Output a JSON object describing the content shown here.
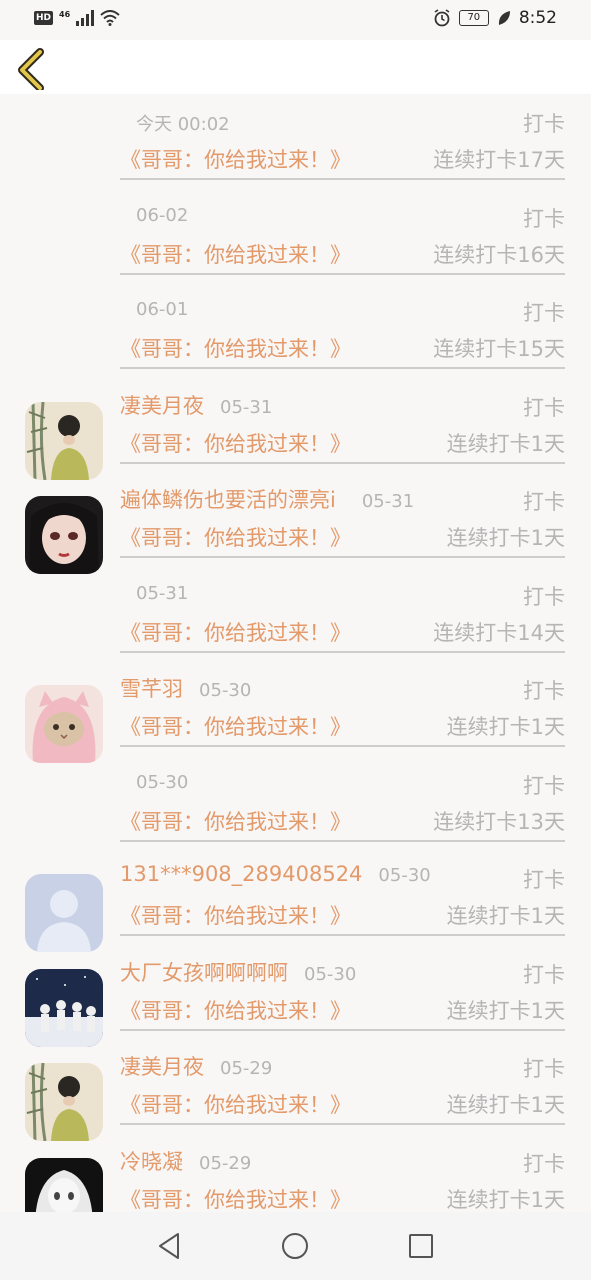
{
  "status_bar": {
    "hd": "HD",
    "network": "46",
    "battery": "70",
    "time": "8:52",
    "icons": [
      "signal-icon",
      "wifi-icon",
      "alarm-icon",
      "battery-icon",
      "leaf-icon"
    ]
  },
  "header": {
    "back_icon": "chevron-left-icon",
    "accent": "#e3c74a"
  },
  "colors": {
    "accent_text": "#e39a6a",
    "muted_text": "#b5b5b5",
    "divider": "#cfcccc"
  },
  "records": [
    {
      "avatar": null,
      "name": "",
      "date": "今天 00:02",
      "action": "打卡",
      "book": "《哥哥：你给我过来！》",
      "streak": "连续打卡17天"
    },
    {
      "avatar": null,
      "name": "",
      "date": "06-02",
      "action": "打卡",
      "book": "《哥哥：你给我过来！》",
      "streak": "连续打卡16天"
    },
    {
      "avatar": null,
      "name": "",
      "date": "06-01",
      "action": "打卡",
      "book": "《哥哥：你给我过来！》",
      "streak": "连续打卡15天"
    },
    {
      "avatar": "girl-bamboo",
      "name": "凄美月夜",
      "date": "05-31",
      "action": "打卡",
      "book": "《哥哥：你给我过来！》",
      "streak": "连续打卡1天"
    },
    {
      "avatar": "girl-black-hair",
      "name": "遍体鳞伤也要活的漂亮i",
      "date": "05-31",
      "action": "打卡",
      "book": "《哥哥：你给我过来！》",
      "streak": "连续打卡1天"
    },
    {
      "avatar": null,
      "name": "",
      "date": "05-31",
      "action": "打卡",
      "book": "《哥哥：你给我过来！》",
      "streak": "连续打卡14天"
    },
    {
      "avatar": "cat-pink",
      "name": "雪芊羽",
      "date": "05-30",
      "action": "打卡",
      "book": "《哥哥：你给我过来！》",
      "streak": "连续打卡1天"
    },
    {
      "avatar": null,
      "name": "",
      "date": "05-30",
      "action": "打卡",
      "book": "《哥哥：你给我过来！》",
      "streak": "连续打卡13天"
    },
    {
      "avatar": "default-user",
      "name": "131***908_289408524",
      "date": "05-30",
      "action": "打卡",
      "book": "《哥哥：你给我过来！》",
      "streak": "连续打卡1天"
    },
    {
      "avatar": "group-night",
      "name": "大厂女孩啊啊啊啊",
      "date": "05-30",
      "action": "打卡",
      "book": "《哥哥：你给我过来！》",
      "streak": "连续打卡1天"
    },
    {
      "avatar": "girl-bamboo",
      "name": "凄美月夜",
      "date": "05-29",
      "action": "打卡",
      "book": "《哥哥：你给我过来！》",
      "streak": "连续打卡1天"
    },
    {
      "avatar": "girl-bw",
      "name": "冷晓凝",
      "date": "05-29",
      "action": "打卡",
      "book": "《哥哥：你给我过来！》",
      "streak": "连续打卡1天"
    }
  ],
  "nav_bar": {
    "icons": [
      "back-triangle-icon",
      "home-circle-icon",
      "recents-square-icon"
    ]
  }
}
